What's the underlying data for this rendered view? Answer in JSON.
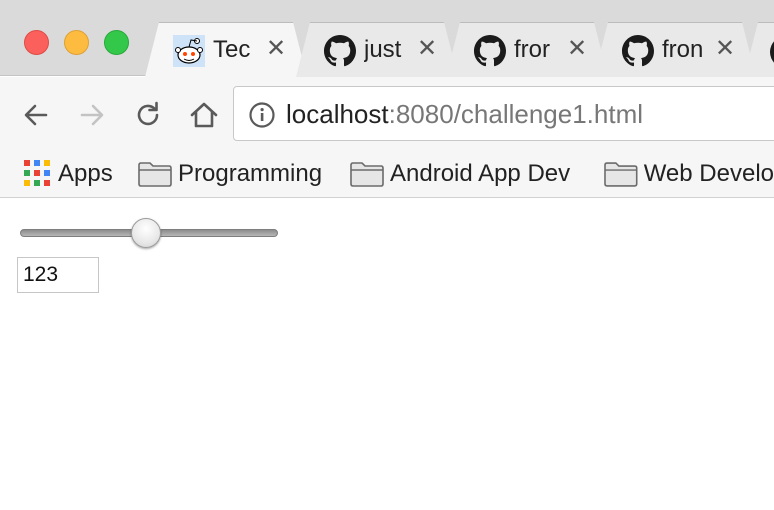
{
  "window": {
    "tabs": [
      {
        "title": "Tec",
        "icon": "reddit-alien-icon",
        "active": true
      },
      {
        "title": "just",
        "icon": "github-octocat-icon",
        "active": false
      },
      {
        "title": "fror",
        "icon": "github-octocat-icon",
        "active": false
      },
      {
        "title": "fron",
        "icon": "github-octocat-icon",
        "active": false
      }
    ],
    "tab_close_glyph": "✕"
  },
  "toolbar": {
    "url_host": "localhost",
    "url_rest": ":8080/challenge1.html"
  },
  "bookmarks": [
    {
      "label": "Apps",
      "icon": "apps-grid-icon"
    },
    {
      "label": "Programming",
      "icon": "folder-icon"
    },
    {
      "label": "Android App Dev",
      "icon": "folder-icon"
    },
    {
      "label": "Web Develo",
      "icon": "folder-icon"
    }
  ],
  "page": {
    "slider": {
      "value_fraction": 0.487
    },
    "number_input": {
      "value": "123"
    }
  },
  "colors": {
    "close": "#fc605c",
    "minimize": "#fdbc40",
    "maximize": "#34c84a"
  }
}
